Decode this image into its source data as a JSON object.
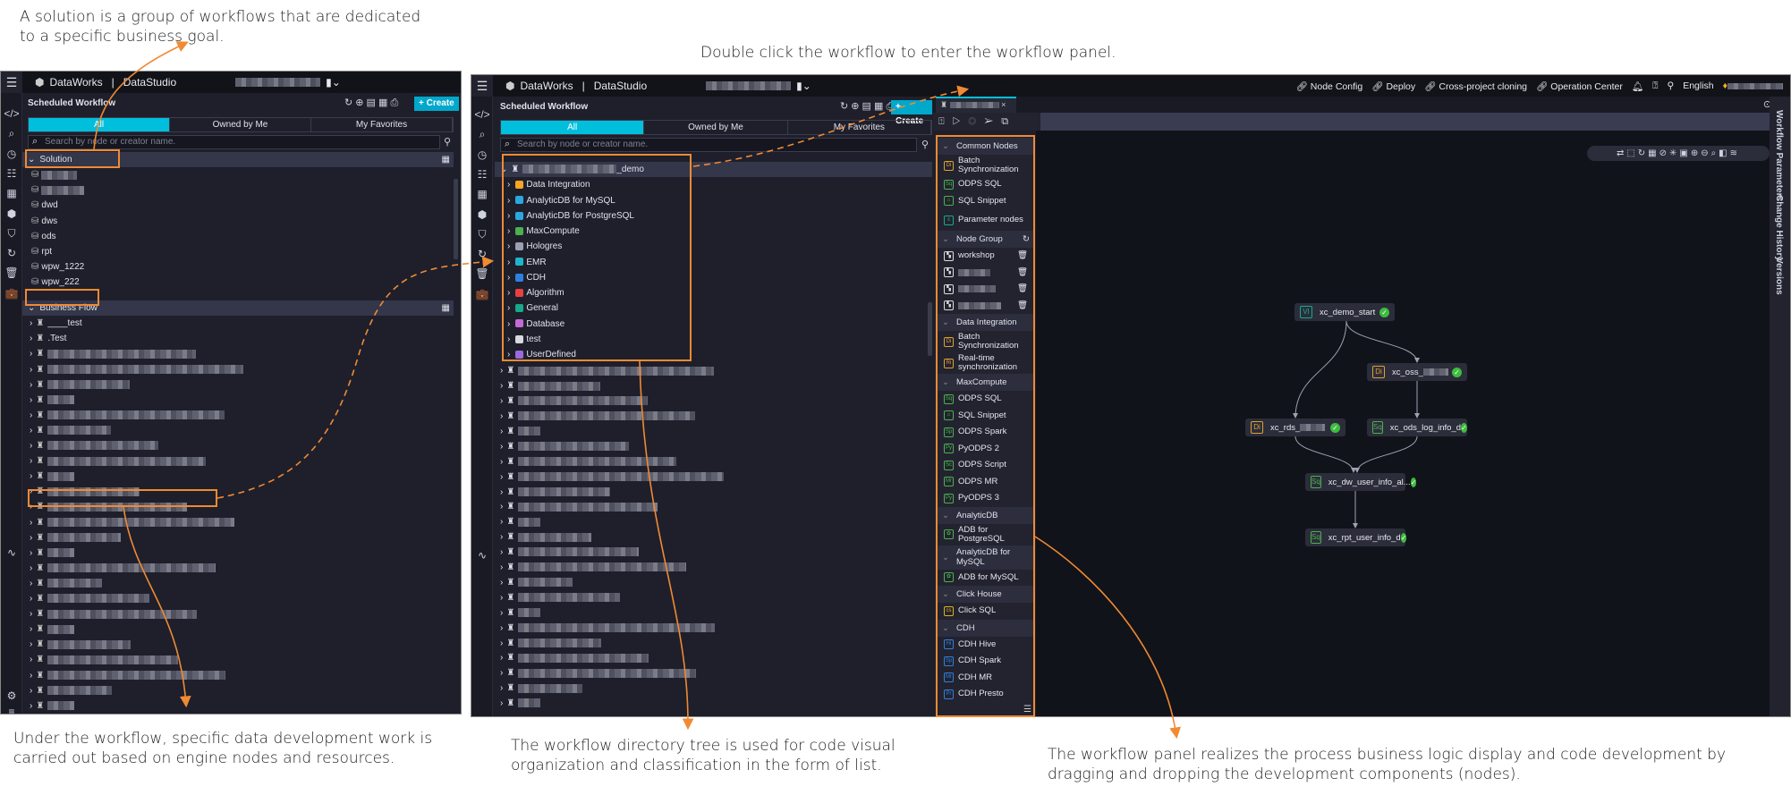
{
  "annotations": {
    "solution": "A solution is a group of workflows that are dedicated\nto a specific business goal.",
    "double_click": "Double click the workflow to enter the workflow panel.",
    "under_workflow": "Under the workflow, specific data development work is\ncarried out based on engine nodes and resources.",
    "directory_tree": "The workflow directory tree is used for code visual\norganization and classification in the form of list.",
    "workflow_panel": "The workflow panel realizes the process business logic display and code development by\ndragging and dropping the development components (nodes)."
  },
  "colors": {
    "accent": "#00bfdc",
    "annotation": "#f08a33",
    "success": "#3dbd3d"
  },
  "app": {
    "brand": "DataWorks",
    "separator": "|",
    "product": "DataStudio",
    "panel_title": "Scheduled Workflow",
    "create_label": "+ Create",
    "tabs": [
      "All",
      "Owned by Me",
      "My Favorites"
    ],
    "search_placeholder": "Search by node or creator name."
  },
  "left": {
    "solution_section": "Solution",
    "solution_items": [
      "",
      "",
      "dwd",
      "dws",
      "ods",
      "rpt",
      "wpw_1222",
      "wpw_222"
    ],
    "business_flow_section": "Business Flow",
    "business_flow_items": [
      "____test",
      ".Test",
      "",
      "",
      "",
      "",
      "",
      "",
      "",
      "",
      "",
      "",
      "",
      "",
      "",
      "",
      "",
      "",
      "",
      "",
      "",
      "",
      "",
      "",
      "",
      "",
      "",
      ""
    ]
  },
  "middle": {
    "header_links": [
      "Node Config",
      "Deploy",
      "Cross-project cloning",
      "Operation Center"
    ],
    "language": "English",
    "root_workflow": "_demo",
    "tree_children": [
      {
        "label": "Data Integration",
        "icon": "data-integration-icon",
        "color": "#f5a623"
      },
      {
        "label": "AnalyticDB for MySQL",
        "icon": "analyticdb-icon",
        "color": "#29a9e0"
      },
      {
        "label": "AnalyticDB for PostgreSQL",
        "icon": "analyticdb-icon",
        "color": "#29a9e0"
      },
      {
        "label": "MaxCompute",
        "icon": "maxcompute-icon",
        "color": "#4caf50"
      },
      {
        "label": "Hologres",
        "icon": "hologres-icon",
        "color": "#9aa0b0"
      },
      {
        "label": "EMR",
        "icon": "emr-icon",
        "color": "#1fb5c9"
      },
      {
        "label": "CDH",
        "icon": "cdh-icon",
        "color": "#2f7fe0"
      },
      {
        "label": "Algorithm",
        "icon": "algorithm-icon",
        "color": "#e84040"
      },
      {
        "label": "General",
        "icon": "general-icon",
        "color": "#1aa88a"
      },
      {
        "label": "Database",
        "icon": "database-icon",
        "color": "#c46ad8"
      },
      {
        "label": "test",
        "icon": "folder-icon",
        "color": "#d8d8e0"
      },
      {
        "label": "UserDefined",
        "icon": "user-defined-icon",
        "color": "#9b6ae0"
      }
    ],
    "other_workflows_count_visible": 23
  },
  "node_list": [
    {
      "section": "Common Nodes",
      "items": [
        {
          "label": "Batch Synchronization",
          "badge": "Di",
          "color": "#e0a030"
        },
        {
          "label": "ODPS SQL",
          "badge": "Sq",
          "color": "#4caf50"
        },
        {
          "label": "SQL Snippet",
          "badge": "⌂",
          "color": "#4caf50"
        },
        {
          "label": "Parameter nodes",
          "badge": "≡",
          "color": "#1aa88a"
        }
      ]
    },
    {
      "section": "Node Group",
      "items": [
        {
          "label": "workshop",
          "badge": "▚",
          "color": "#ddd",
          "delete": true
        },
        {
          "label": "",
          "badge": "▚",
          "color": "#ddd",
          "delete": true
        },
        {
          "label": "",
          "badge": "▚",
          "color": "#ddd",
          "delete": true
        },
        {
          "label": "",
          "badge": "▚",
          "color": "#ddd",
          "delete": true
        }
      ]
    },
    {
      "section": "Data Integration",
      "items": [
        {
          "label": "Batch Synchronization",
          "badge": "Di",
          "color": "#e0a030"
        },
        {
          "label": "Real-time synchronization",
          "badge": "Ri",
          "color": "#e0a030"
        }
      ]
    },
    {
      "section": "MaxCompute",
      "items": [
        {
          "label": "ODPS SQL",
          "badge": "Sq",
          "color": "#4caf50"
        },
        {
          "label": "SQL Snippet",
          "badge": "⌂",
          "color": "#4caf50"
        },
        {
          "label": "ODPS Spark",
          "badge": "Sp",
          "color": "#4caf50"
        },
        {
          "label": "PyODPS 2",
          "badge": "Py",
          "color": "#4caf50"
        },
        {
          "label": "ODPS Script",
          "badge": "Sc",
          "color": "#4caf50"
        },
        {
          "label": "ODPS MR",
          "badge": "Mr",
          "color": "#4caf50"
        },
        {
          "label": "PyODPS 3",
          "badge": "Py",
          "color": "#4caf50"
        }
      ]
    },
    {
      "section": "AnalyticDB",
      "items": [
        {
          "label": "ADB for PostgreSQL",
          "badge": "✿",
          "color": "#4caf50"
        }
      ]
    },
    {
      "section": "AnalyticDB for MySQL",
      "items": [
        {
          "label": "ADB for MySQL",
          "badge": "✿",
          "color": "#4caf50"
        }
      ]
    },
    {
      "section": "Click House",
      "items": [
        {
          "label": "Click SQL",
          "badge": "cs",
          "color": "#e0b020"
        }
      ]
    },
    {
      "section": "CDH",
      "items": [
        {
          "label": "CDH Hive",
          "badge": "Hi",
          "color": "#2f7fe0"
        },
        {
          "label": "CDH Spark",
          "badge": "Sp",
          "color": "#2f7fe0"
        },
        {
          "label": "CDH MR",
          "badge": "Mr",
          "color": "#2f7fe0"
        },
        {
          "label": "CDH Presto",
          "badge": "Pr",
          "color": "#2f7fe0"
        }
      ]
    }
  ],
  "dag": {
    "nodes": [
      {
        "name": "xc_demo_start",
        "type": "VI",
        "color": "#1aa88a",
        "status": "success"
      },
      {
        "name": "xc_oss_",
        "type": "Di",
        "color": "#e0a030",
        "status": "success",
        "blurred_suffix": true
      },
      {
        "name": "xc_rds_",
        "type": "Di",
        "color": "#e0a030",
        "status": "success",
        "blurred_suffix": true
      },
      {
        "name": "xc_ods_log_info_d",
        "type": "Sq",
        "color": "#4caf50",
        "status": "success"
      },
      {
        "name": "xc_dw_user_info_al...",
        "type": "Sq",
        "color": "#4caf50",
        "status": "success"
      },
      {
        "name": "xc_rpt_user_info_d",
        "type": "Sq",
        "color": "#4caf50",
        "status": "success"
      }
    ],
    "edges": [
      [
        0,
        1
      ],
      [
        0,
        2
      ],
      [
        1,
        3
      ],
      [
        2,
        4
      ],
      [
        3,
        4
      ],
      [
        4,
        5
      ]
    ]
  },
  "right_tabs": [
    "Workflow Parameters",
    "Change History",
    "Versions"
  ]
}
